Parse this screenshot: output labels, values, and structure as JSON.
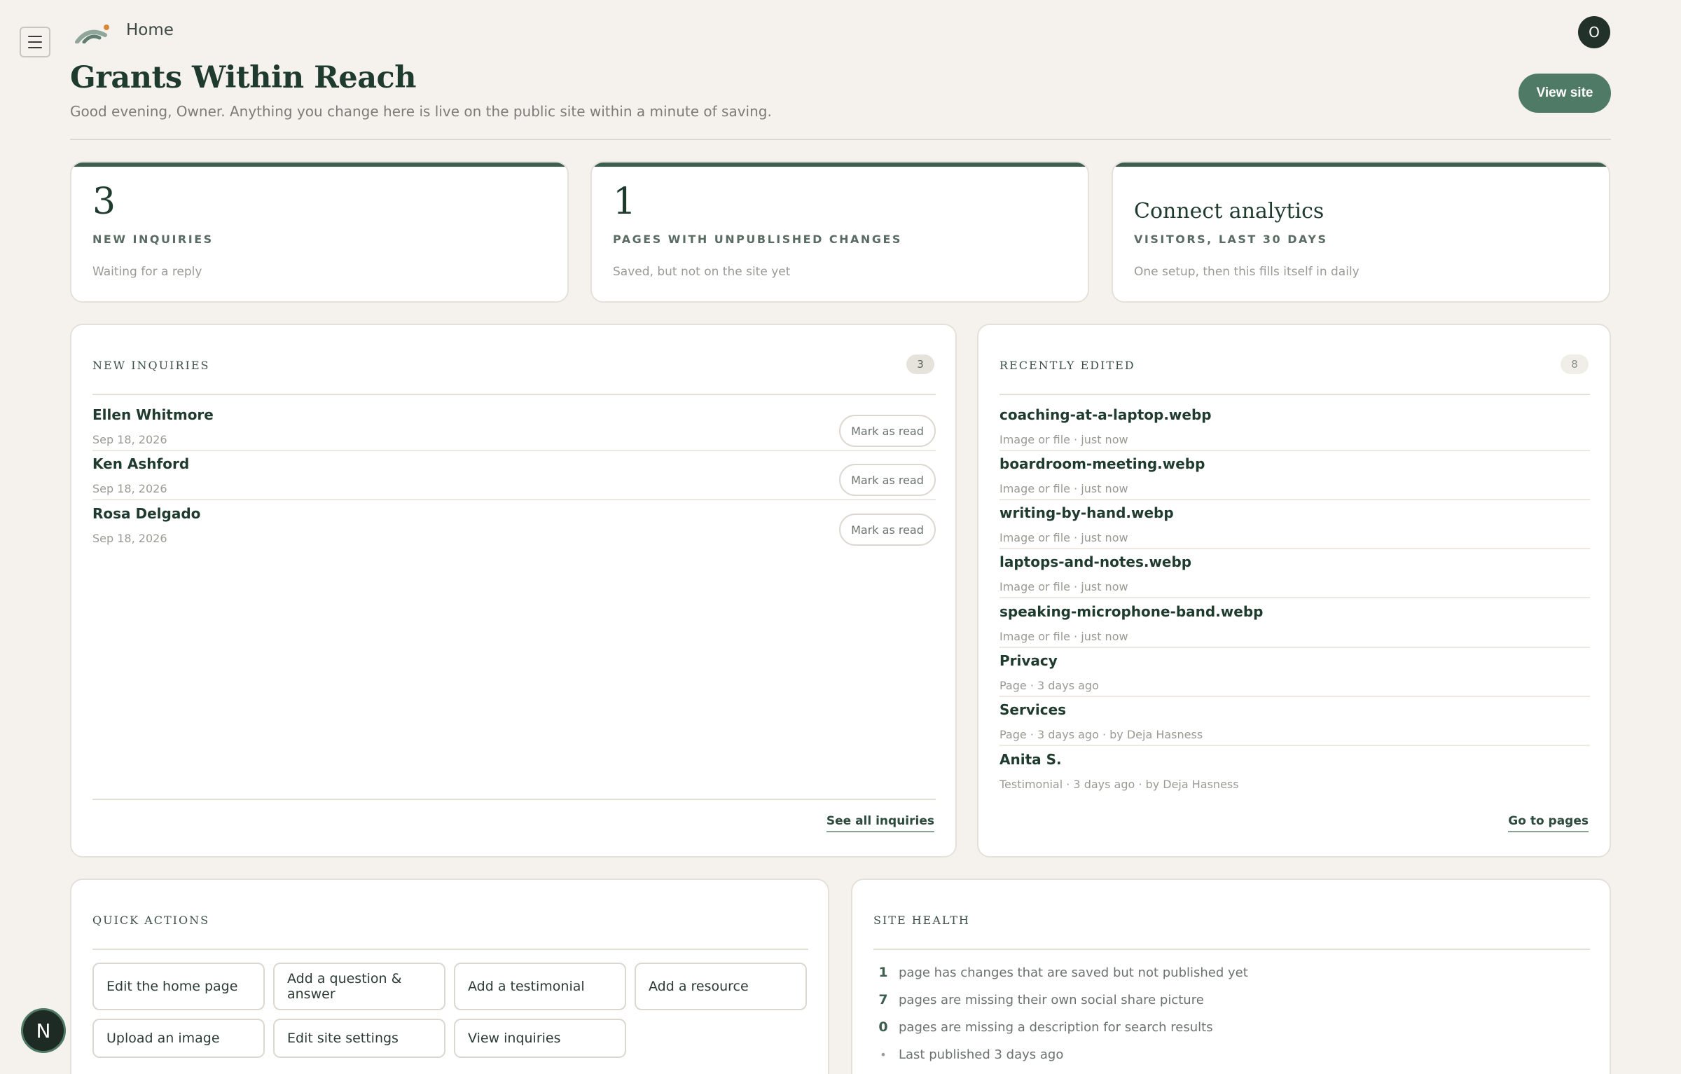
{
  "topbar": {
    "breadcrumb": "Home",
    "avatar_initial": "O"
  },
  "header": {
    "title": "Grants Within Reach",
    "subtitle": "Good evening, Owner. Anything you change here is live on the public site within a minute of saving.",
    "view_site_label": "View site"
  },
  "stats": [
    {
      "value": "3",
      "label": "NEW INQUIRIES",
      "hint": "Waiting for a reply"
    },
    {
      "value": "1",
      "label": "PAGES WITH UNPUBLISHED CHANGES",
      "hint": "Saved, but not on the site yet"
    },
    {
      "value": "Connect analytics",
      "label": "VISITORS, LAST 30 DAYS",
      "hint": "One setup, then this fills itself in daily"
    }
  ],
  "inquiries": {
    "title": "NEW INQUIRIES",
    "count": "3",
    "items": [
      {
        "name": "Ellen Whitmore",
        "date": "Sep 18, 2026",
        "action": "Mark as read"
      },
      {
        "name": "Ken Ashford",
        "date": "Sep 18, 2026",
        "action": "Mark as read"
      },
      {
        "name": "Rosa Delgado",
        "date": "Sep 18, 2026",
        "action": "Mark as read"
      }
    ],
    "footer_link": "See all inquiries"
  },
  "recent": {
    "title": "RECENTLY EDITED",
    "count": "8",
    "items": [
      {
        "name": "coaching-at-a-laptop.webp",
        "meta": "Image or file · just now"
      },
      {
        "name": "boardroom-meeting.webp",
        "meta": "Image or file · just now"
      },
      {
        "name": "writing-by-hand.webp",
        "meta": "Image or file · just now"
      },
      {
        "name": "laptops-and-notes.webp",
        "meta": "Image or file · just now"
      },
      {
        "name": "speaking-microphone-band.webp",
        "meta": "Image or file · just now"
      },
      {
        "name": "Privacy",
        "meta": "Page · 3 days ago"
      },
      {
        "name": "Services",
        "meta": "Page · 3 days ago · by Deja Hasness"
      },
      {
        "name": "Anita S.",
        "meta": "Testimonial · 3 days ago · by Deja Hasness"
      }
    ],
    "footer_link": "Go to pages"
  },
  "quick_actions": {
    "title": "QUICK ACTIONS",
    "items": [
      "Edit the home page",
      "Add a question & answer",
      "Add a testimonial",
      "Add a resource",
      "Upload an image",
      "Edit site settings",
      "View inquiries"
    ]
  },
  "site_health": {
    "title": "SITE HEALTH",
    "items": [
      {
        "count": "1",
        "text": "page has changes that are saved but not published yet"
      },
      {
        "count": "7",
        "text": "pages are missing their own social share picture"
      },
      {
        "count": "0",
        "text": "pages are missing a description for search results"
      },
      {
        "count": "•",
        "text": "Last published 3 days ago"
      }
    ]
  },
  "fab_label": "N",
  "colors": {
    "accent": "#4f7a66",
    "stat_bar": "#3e5f50",
    "background": "#f5f1ec",
    "logo_dot": "#d9883a"
  }
}
